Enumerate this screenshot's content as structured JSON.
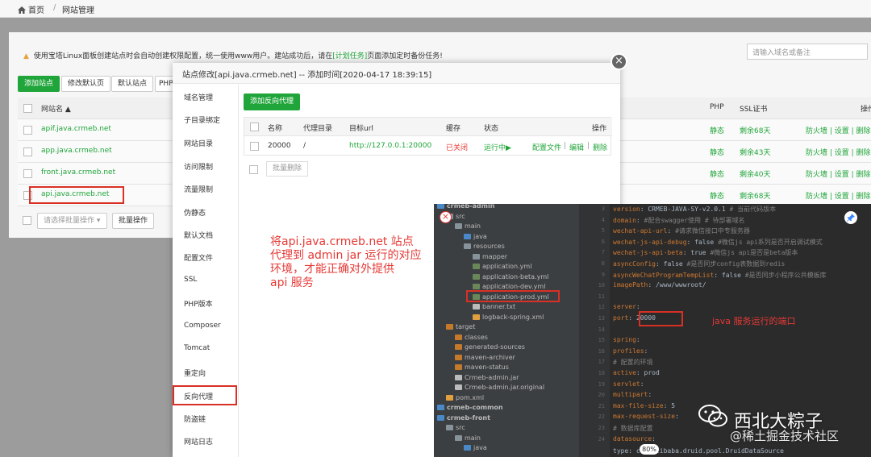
{
  "breadcrumb": {
    "home": "首页",
    "separator": "/",
    "current": "网站管理"
  },
  "notice": {
    "text_before": "使用宝塔Linux面板创建站点时会自动创建权限配置，统一使用www用户。建站成功后，请在",
    "link": "[计划任务]",
    "text_after": "页面添加定时备份任务!"
  },
  "toolbar": {
    "add_site": "添加站点",
    "edit_default_page": "修改默认页",
    "default_site": "默认站点",
    "php_trunc": "PHP"
  },
  "site_search": {
    "placeholder": "请输入域名或备注"
  },
  "site_table": {
    "headers": {
      "name": "网站名 ▲",
      "php": "PHP",
      "ssl": "SSL证书",
      "ops": "操作"
    },
    "rows": [
      {
        "name": "apif.java.crmeb.net",
        "php": "静态",
        "ssl": "剩余68天",
        "ops": "防火墙 | 设置 | 删除"
      },
      {
        "name": "app.java.crmeb.net",
        "php": "静态",
        "ssl": "剩余43天",
        "ops": "防火墙 | 设置 | 删除"
      },
      {
        "name": "front.java.crmeb.net",
        "php": "静态",
        "ssl": "剩余40天",
        "ops": "防火墙 | 设置 | 删除"
      },
      {
        "name": "api.java.crmeb.net",
        "php": "静态",
        "ssl": "剩余68天",
        "ops": "防火墙 | 设置 | 删除"
      }
    ],
    "batch_select": "请选择批量操作",
    "batch_button": "批量操作"
  },
  "modal": {
    "title": "站点修改[api.java.crmeb.net] -- 添加时间[2020-04-17 18:39:15]",
    "close": "×",
    "sidebar": [
      "域名管理",
      "子目录绑定",
      "网站目录",
      "访问限制",
      "流量限制",
      "伪静态",
      "默认文档",
      "配置文件",
      "SSL",
      "PHP版本",
      "Composer",
      "Tomcat",
      "重定向",
      "反向代理",
      "防盗链",
      "网站日志"
    ],
    "add_proxy": "添加反向代理",
    "proxy_table": {
      "headers": {
        "name": "名称",
        "dir": "代理目录",
        "url": "目标url",
        "cache": "缓存",
        "status": "状态",
        "ops": "操作"
      },
      "row": {
        "name": "20000",
        "dir": "/",
        "url": "http://127.0.0.1:20000",
        "cache": "已关闭",
        "status": "运行中▶",
        "op_config": "配置文件",
        "op_edit": "编辑",
        "op_delete": "删除",
        "sep": "|"
      }
    },
    "batch_delete": "批量删除"
  },
  "annotation_left": [
    "将api.java.crmeb.net 站点",
    "代理到 admin jar 运行的对应",
    "环境，才能正确对外提供",
    "api 服务"
  ],
  "annotation_right": "java 服务运行的端口",
  "ide": {
    "tree": [
      {
        "label": "crmeb-admin",
        "bold": true,
        "indent": 0,
        "kind": "module"
      },
      {
        "label": "src",
        "indent": 1,
        "kind": "folder"
      },
      {
        "label": "main",
        "indent": 2,
        "kind": "folder"
      },
      {
        "label": "java",
        "indent": 3,
        "kind": "folder-blue"
      },
      {
        "label": "resources",
        "indent": 3,
        "kind": "folder"
      },
      {
        "label": "mapper",
        "indent": 4,
        "kind": "folder"
      },
      {
        "label": "application.yml",
        "indent": 4,
        "kind": "yml"
      },
      {
        "label": "application-beta.yml",
        "indent": 4,
        "kind": "yml"
      },
      {
        "label": "application-dev.yml",
        "indent": 4,
        "kind": "yml"
      },
      {
        "label": "application-prod.yml",
        "indent": 4,
        "kind": "yml"
      },
      {
        "label": "banner.txt",
        "indent": 4,
        "kind": "txt"
      },
      {
        "label": "logback-spring.xml",
        "indent": 4,
        "kind": "xml"
      },
      {
        "label": "target",
        "indent": 1,
        "kind": "folder-orange"
      },
      {
        "label": "classes",
        "indent": 2,
        "kind": "folder-orange"
      },
      {
        "label": "generated-sources",
        "indent": 2,
        "kind": "folder-orange"
      },
      {
        "label": "maven-archiver",
        "indent": 2,
        "kind": "folder-orange"
      },
      {
        "label": "maven-status",
        "indent": 2,
        "kind": "folder-orange"
      },
      {
        "label": "Crmeb-admin.jar",
        "indent": 2,
        "kind": "jar"
      },
      {
        "label": "Crmeb-admin.jar.original",
        "indent": 2,
        "kind": "txt"
      },
      {
        "label": "pom.xml",
        "indent": 1,
        "kind": "xml"
      },
      {
        "label": "crmeb-common",
        "bold": true,
        "indent": 0,
        "kind": "module"
      },
      {
        "label": "crmeb-front",
        "bold": true,
        "indent": 0,
        "kind": "module"
      },
      {
        "label": "src",
        "indent": 1,
        "kind": "folder"
      },
      {
        "label": "main",
        "indent": 2,
        "kind": "folder"
      },
      {
        "label": "java",
        "indent": 3,
        "kind": "folder-blue"
      }
    ],
    "line_numbers": [
      "3",
      "4",
      "5",
      "6",
      "7",
      "8",
      "9",
      "10",
      "11",
      "12",
      "13",
      "14",
      "15",
      "16",
      "17",
      "18",
      "19",
      "20",
      "21",
      "22",
      "23",
      "24"
    ],
    "code": [
      {
        "key": "version",
        "val": " CRMEB-JAVA-SY-v2.0.1",
        "cmt": " # 当前代码版本"
      },
      {
        "key": "domain",
        "val": "",
        "cmt": " #配合swagger使用 # 待部署域名"
      },
      {
        "key": "wechat-api-url",
        "val": "",
        "cmt": "  #请求微信接口中专服务器"
      },
      {
        "key": "wechat-js-api-debug",
        "val": " false",
        "cmt": " #微信js api系列是否开启调试模式"
      },
      {
        "key": "wechat-js-api-beta",
        "val": " true",
        "cmt": " #微信js api是否是beta版本"
      },
      {
        "key": "asyncConfig",
        "val": " false",
        "cmt": " #是否同步config表数据到redis"
      },
      {
        "key": "asyncWeChatProgramTempList",
        "val": " false",
        "cmt": " #是否同步小程序公共模板库"
      },
      {
        "key": "imagePath",
        "val": " /www/wwwroot/",
        "cmt": ""
      },
      {
        "key": "",
        "val": "",
        "cmt": ""
      },
      {
        "key": "server",
        "val": "",
        "cmt": ""
      },
      {
        "key": "  port",
        "val": " 20000",
        "cmt": ""
      },
      {
        "key": "",
        "val": "",
        "cmt": ""
      },
      {
        "key": "spring",
        "val": "",
        "cmt": ""
      },
      {
        "key": "  profiles",
        "val": "",
        "cmt": ""
      },
      {
        "key": "",
        "val": "",
        "cmt": "    #  配置的环境"
      },
      {
        "key": "    active",
        "val": " prod",
        "cmt": ""
      },
      {
        "key": "  servlet",
        "val": "",
        "cmt": ""
      },
      {
        "key": "    multipart",
        "val": "",
        "cmt": ""
      },
      {
        "key": "      max-file-size",
        "val": " 5",
        "cmt": ""
      },
      {
        "key": "      max-request-size",
        "val": "",
        "cmt": ""
      },
      {
        "key": "",
        "val": "",
        "cmt": "    #  数据库配置"
      },
      {
        "key": "  datasource",
        "val": "",
        "cmt": ""
      }
    ],
    "last_line": "    type: com.alibaba.druid.pool.DruidDataSource",
    "zoom": "80%"
  },
  "watermark": {
    "name": "西北大粽子",
    "source": "@稀土掘金技术社区"
  },
  "colors": {
    "green": "#20a53a",
    "red": "#d93025",
    "ide_bg": "#2b2b2b"
  }
}
